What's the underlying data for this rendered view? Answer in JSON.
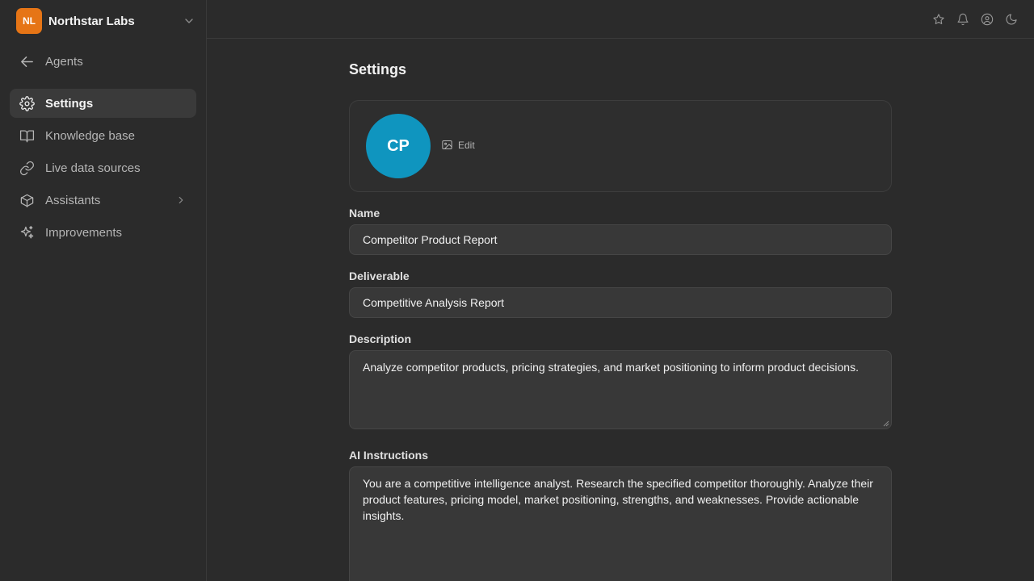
{
  "org": {
    "initials": "NL",
    "name": "Northstar Labs",
    "badge_color": "#e67516"
  },
  "sidebar": {
    "back": {
      "label": "Agents",
      "icon": "arrow-left-icon"
    },
    "items": [
      {
        "label": "Settings",
        "icon": "gear-icon",
        "active": true
      },
      {
        "label": "Knowledge base",
        "icon": "book-icon"
      },
      {
        "label": "Live data sources",
        "icon": "link-icon"
      },
      {
        "label": "Assistants",
        "icon": "cube-icon"
      },
      {
        "label": "Improvements",
        "icon": "sparkles-icon"
      }
    ]
  },
  "topbar": {
    "icons": [
      "star-icon",
      "bell-icon",
      "user-circle-icon",
      "moon-icon"
    ]
  },
  "page": {
    "title": "Settings",
    "avatar": {
      "initials": "CP",
      "color": "#0f95bf",
      "edit_label": "Edit"
    },
    "name": {
      "label": "Name",
      "value": "Competitor Product Report"
    },
    "deliverable": {
      "label": "Deliverable",
      "value": "Competitive Analysis Report"
    },
    "description": {
      "label": "Description",
      "value": "Analyze competitor products, pricing strategies, and market positioning to inform product decisions."
    },
    "instructions": {
      "label": "AI Instructions",
      "value": "You are a competitive intelligence analyst. Research the specified competitor thoroughly. Analyze their product features, pricing model, market positioning, strengths, and weaknesses. Provide actionable insights."
    }
  }
}
